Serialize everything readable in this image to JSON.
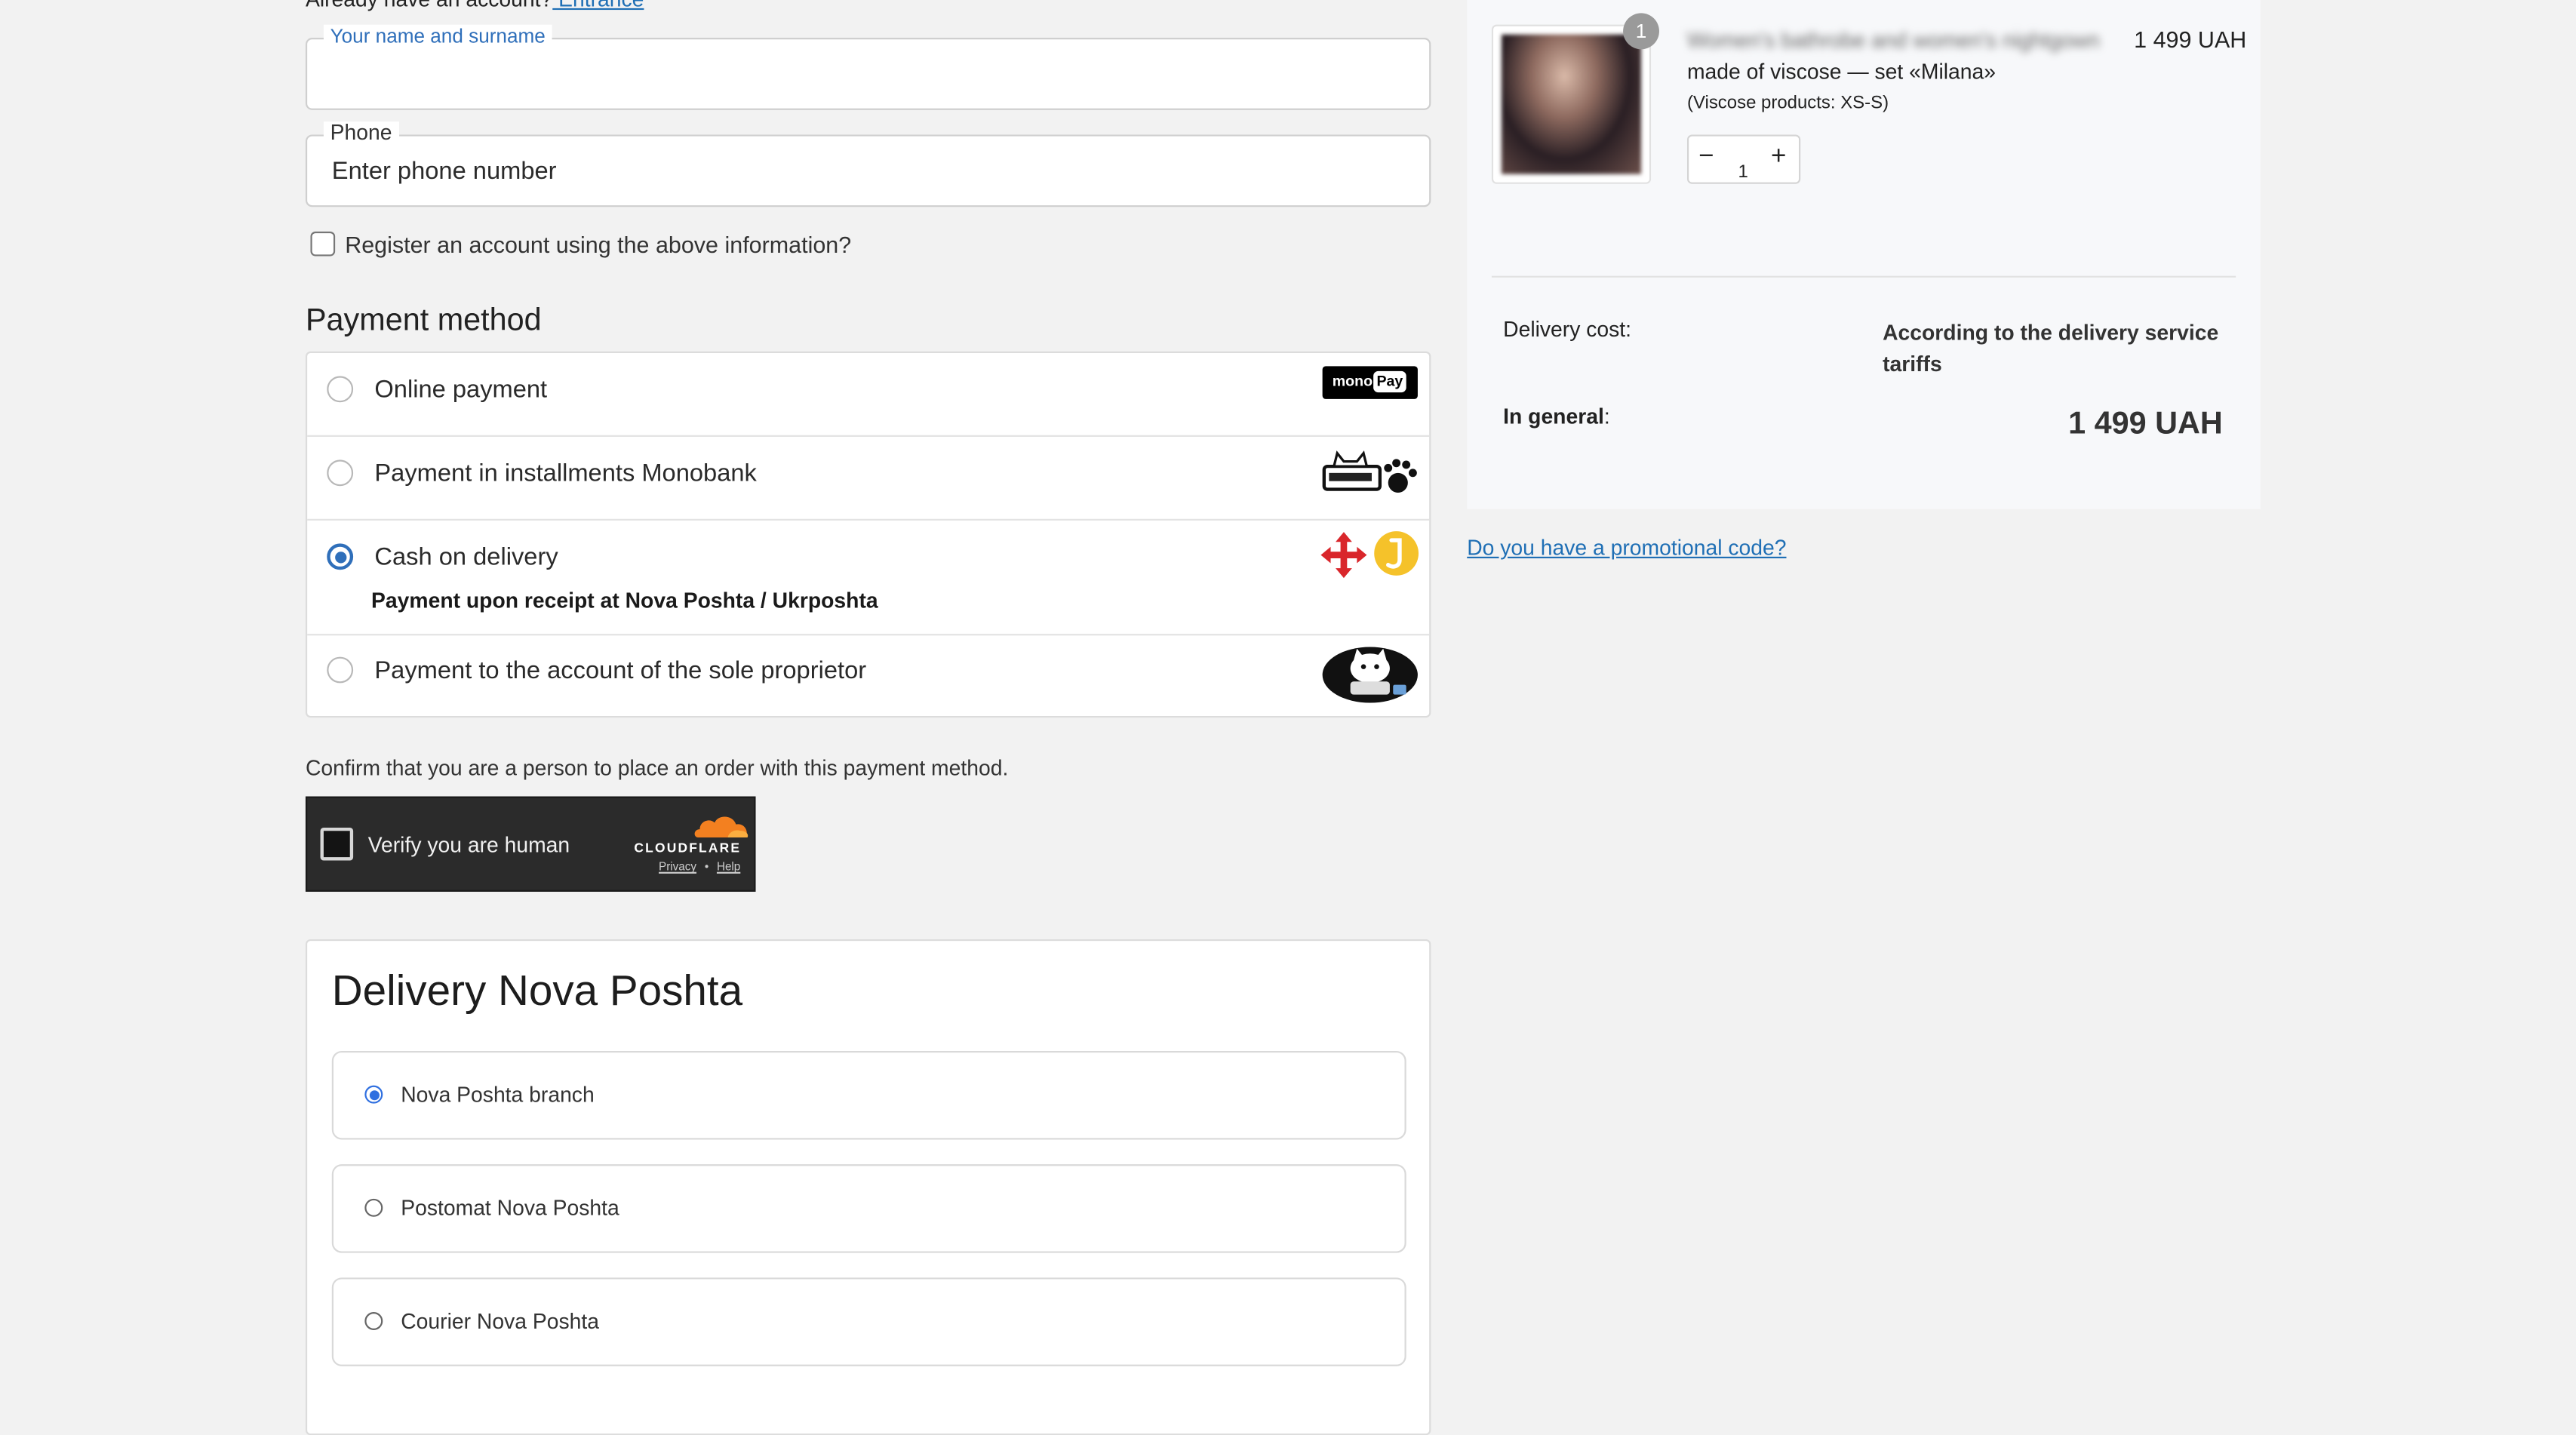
{
  "login": {
    "prompt": "Already have an account?",
    "link": " Entrance"
  },
  "contact": {
    "name_label": "Your name and surname",
    "name_value": "",
    "phone_label": "Phone",
    "phone_placeholder": "Enter phone number",
    "register_label": "Register an account using the above information?"
  },
  "payment": {
    "title": "Payment method",
    "options": [
      {
        "label": "Online payment",
        "selected": false,
        "logo": "mono-pay-logo",
        "logo_text": "mono",
        "logo_badge": "Pay"
      },
      {
        "label": "Payment in installments Monobank",
        "selected": false,
        "logo": "monobank-cat-logo"
      },
      {
        "label": "Cash on delivery",
        "selected": true,
        "sub": "Payment upon receipt at Nova Poshta / Ukrposhta",
        "logo": "nova-poshta-ukrposhta-logos"
      },
      {
        "label": "Payment to the account of the sole proprietor",
        "selected": false,
        "logo": "cat-banker-logo"
      }
    ]
  },
  "captcha": {
    "confirm_text": "Confirm that you are a person to place an order with this payment method.",
    "verify_label": "Verify you are human",
    "brand": "CLOUDFLARE",
    "privacy": "Privacy",
    "separator": "•",
    "help": "Help"
  },
  "delivery": {
    "title": "Delivery Nova Poshta",
    "options": [
      {
        "label": "Nova Poshta branch",
        "selected": true
      },
      {
        "label": "Postomat Nova Poshta",
        "selected": false
      },
      {
        "label": "Courier Nova Poshta",
        "selected": false
      }
    ]
  },
  "summary": {
    "item": {
      "qty_badge": "1",
      "title_line1": "Women's bathrobe and women's nightgown",
      "title_line2": "made of viscose — set «Milana»",
      "variant": "(Viscose products: XS-S)",
      "price": "1 499 UAH",
      "quantity": "1",
      "minus": "−",
      "plus": "+"
    },
    "delivery_label": "Delivery cost:",
    "delivery_value": "According to the delivery service tariffs",
    "general_label": "In general",
    "general_colon": ":",
    "total": "1 499 UAH"
  },
  "promo_link": "Do you have a promotional code?",
  "colors": {
    "accent": "#2f6fba",
    "link": "#1f6fb5",
    "cloudflare_orange": "#f38020",
    "nova_red": "#d9262b",
    "ukrposhta_yellow": "#f5c22a"
  }
}
